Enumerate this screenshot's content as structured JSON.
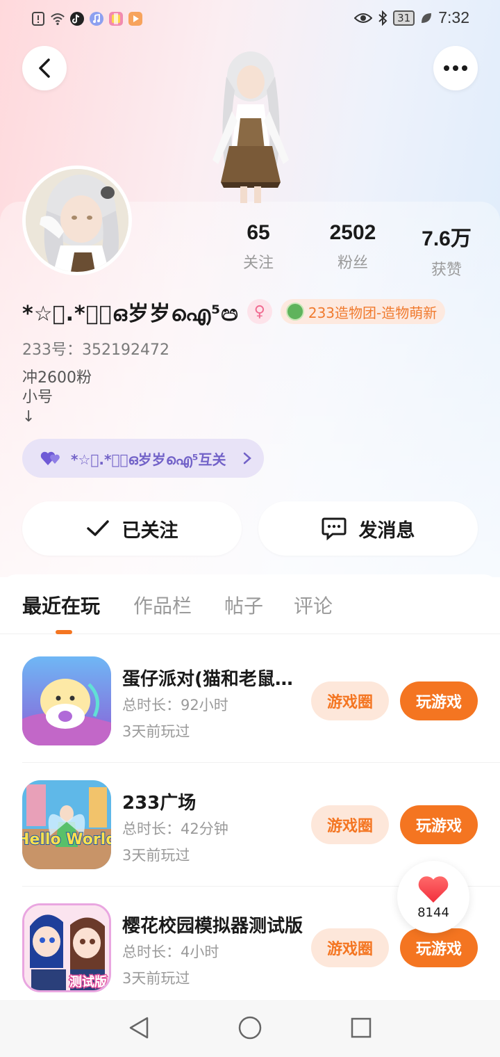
{
  "status_bar": {
    "time": "7:32",
    "battery": "31",
    "left_icons": [
      "alert-icon",
      "wifi-icon",
      "tiktok-icon",
      "music-icon",
      "app-icon",
      "video-icon"
    ],
    "right_icons": [
      "eye-icon",
      "bluetooth-icon",
      "battery-icon",
      "leaf-icon"
    ]
  },
  "header": {
    "back_icon": "back-arrow-icon",
    "more_icon": "more-dots-icon"
  },
  "profile": {
    "stats": [
      {
        "value": "65",
        "label": "关注"
      },
      {
        "value": "2502",
        "label": "粉丝"
      },
      {
        "value": "7.6万",
        "label": "获赞"
      }
    ],
    "nickname": "*☆ﾟ.*･｡ഒ岁岁ഐ⁵ඏ",
    "gender_symbol": "♀",
    "badge_text": "233造物团-造物萌新",
    "uid_text": "233号：352192472",
    "bio_lines": [
      "冲2600粉",
      "小号",
      "↓"
    ],
    "mutual_text": "*☆ﾟ.*･｡ഒ岁岁ഐ⁵互关",
    "follow_label": "已关注",
    "message_label": "发消息"
  },
  "tabs": [
    {
      "label": "最近在玩",
      "active": true
    },
    {
      "label": "作品栏",
      "active": false
    },
    {
      "label": "帖子",
      "active": false
    },
    {
      "label": "评论",
      "active": false
    }
  ],
  "games": [
    {
      "title": "蛋仔派对(猫和老鼠联动)",
      "duration": "总时长：92小时",
      "last_played": "3天前玩过",
      "circle_label": "游戏圈",
      "play_label": "玩游戏"
    },
    {
      "title": "233广场",
      "duration": "总时长：42分钟",
      "last_played": "3天前玩过",
      "circle_label": "游戏圈",
      "play_label": "玩游戏"
    },
    {
      "title": "樱花校园模拟器测试版",
      "duration": "总时长：4小时",
      "last_played": "3天前玩过",
      "circle_label": "游戏圈",
      "play_label": "玩游戏"
    }
  ],
  "game_icon_texts": {
    "game2": "Hello World",
    "game3": "测试版"
  },
  "like_float": {
    "count": "8144"
  },
  "colors": {
    "accent": "#f47521",
    "accent_light": "#fde7da",
    "mutual_bg": "#e8e3f7",
    "mutual_text": "#7262c8"
  }
}
